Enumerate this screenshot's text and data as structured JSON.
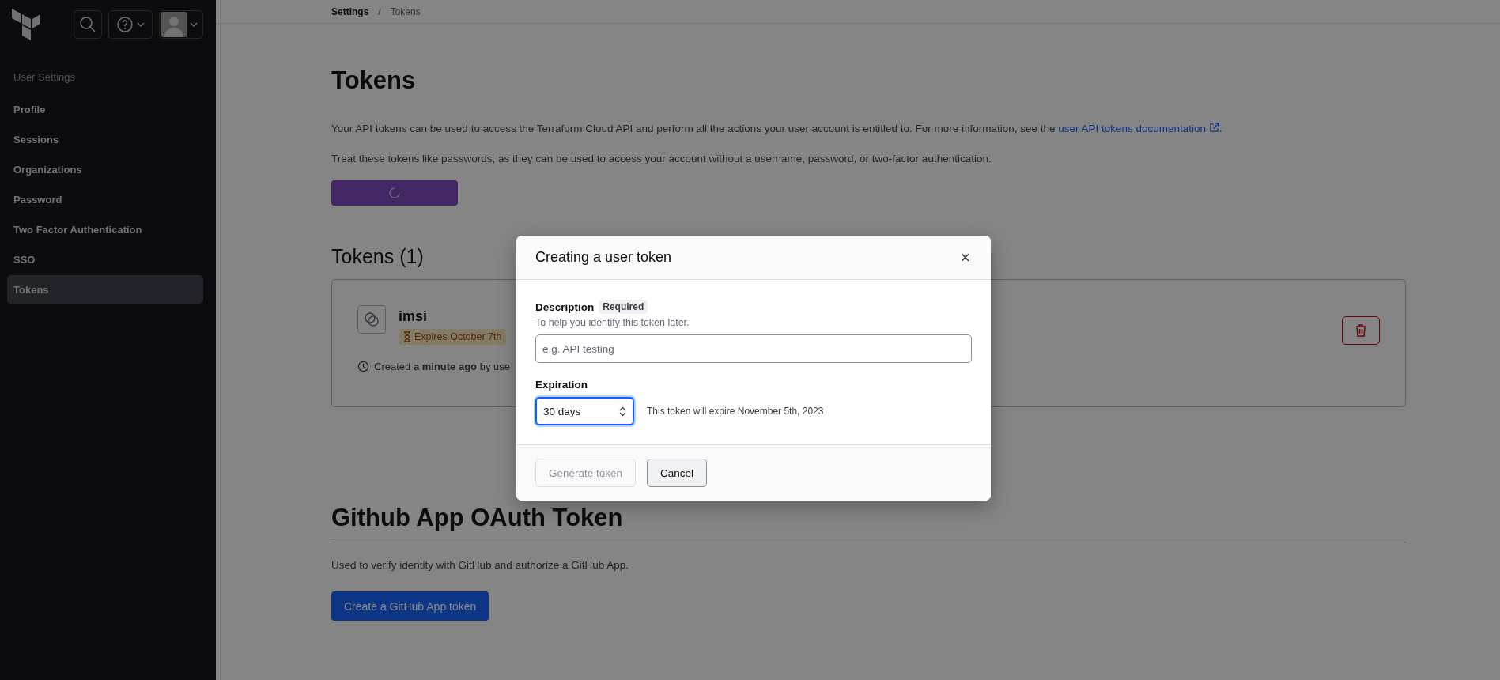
{
  "sidebar": {
    "section_title": "User Settings",
    "items": [
      {
        "label": "Profile",
        "selected": false
      },
      {
        "label": "Sessions",
        "selected": false
      },
      {
        "label": "Organizations",
        "selected": false
      },
      {
        "label": "Password",
        "selected": false
      },
      {
        "label": "Two Factor Authentication",
        "selected": false
      },
      {
        "label": "SSO",
        "selected": false
      },
      {
        "label": "Tokens",
        "selected": true
      }
    ]
  },
  "breadcrumb": [
    "Settings",
    "/",
    "Tokens"
  ],
  "page": {
    "title": "Tokens",
    "intro": {
      "text_before": "Your API tokens can be used to access the Terraform Cloud API and perform all the actions your user account is entitled to. For more information, see the ",
      "link": "user API tokens documentation",
      "text_after": "."
    },
    "warning": "Treat these tokens like passwords, as they can be used to access your account without a username, password, or two-factor authentication.",
    "tokens_heading": "Tokens (1)",
    "tokens": [
      {
        "name": "imsi",
        "expiry": "Expires October 7th",
        "created": "Created **a minute ago** by use"
      }
    ],
    "github": {
      "title": "Github App OAuth Token",
      "text": "Used to verify identity with GitHub and authorize a GitHub App.",
      "button": "Create a GitHub App token"
    }
  },
  "modal": {
    "title": "Creating a user token",
    "close": "×",
    "description": {
      "label": "Description",
      "badge": "Required",
      "help": "To help you identify this token later.",
      "placeholder": "e.g. API testing"
    },
    "expiration": {
      "label": "Expiration",
      "value": "30 days",
      "focused": true,
      "hint": "This token will expire November 5th, 2023"
    },
    "buttons": [
      {
        "label": "Generate token",
        "kind": "primary",
        "disabled": true
      },
      {
        "label": "Cancel",
        "kind": "secondary",
        "disabled": false
      }
    ]
  }
}
